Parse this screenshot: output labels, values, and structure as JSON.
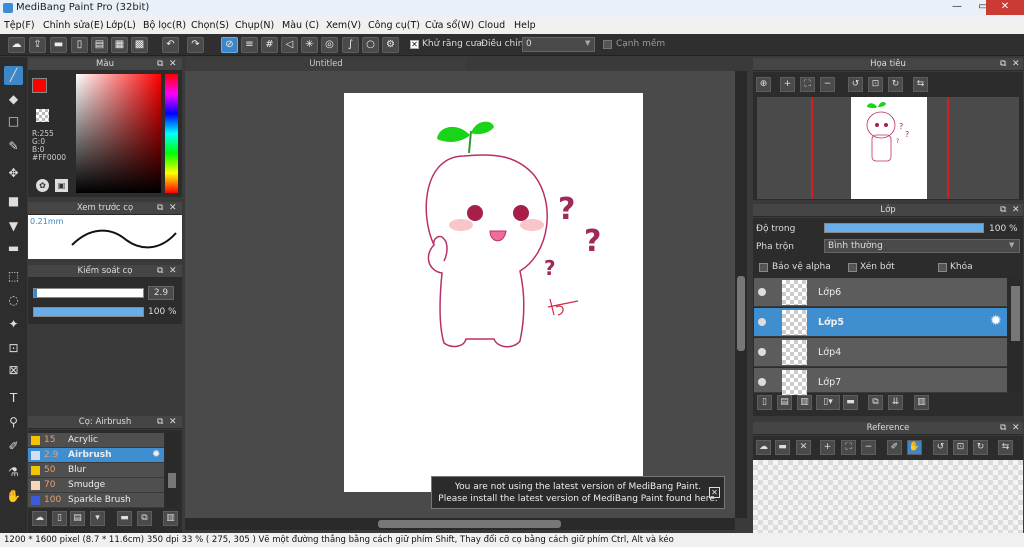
{
  "window": {
    "title": "MediBang Paint Pro (32bit)",
    "min": "—",
    "max": "▭",
    "close": "✕"
  },
  "menu": [
    "Tệp(F)",
    "Chỉnh sửa(E)",
    "Lớp(L)",
    "Bộ lọc(R)",
    "Chọn(S)",
    "Chụp(N)",
    "Màu (C)",
    "Xem(V)",
    "Công cụ(T)",
    "Cửa sổ(W)",
    "Cloud",
    "Help"
  ],
  "toolbar": {
    "antialias_label": "Khử răng cưa",
    "adjust_label": "Điều chỉnh",
    "adjust_value": "0",
    "edge_label": "Cạnh mềm"
  },
  "color_panel": {
    "title": "Màu",
    "r": "R:255",
    "g": "G:0",
    "b": "B:0",
    "hex": "#FF0000",
    "primary": "#ff0000"
  },
  "brush_preview": {
    "title": "Xem trước cọ",
    "size": "0.21mm"
  },
  "brush_control": {
    "title": "Kiểm soát cọ",
    "size": "2.9",
    "opacity": "100 %"
  },
  "brush_panel": {
    "title": "Cọ: Airbrush",
    "items": [
      {
        "size": "15",
        "name": "Acrylic",
        "color": "#f5c400"
      },
      {
        "size": "2.9",
        "name": "Airbrush",
        "color": "#cfe0f5"
      },
      {
        "size": "50",
        "name": "Blur",
        "color": "#f5c400"
      },
      {
        "size": "70",
        "name": "Smudge",
        "color": "#f5d6b8"
      },
      {
        "size": "100",
        "name": "Sparkle Brush",
        "color": "#3a5ad8"
      }
    ]
  },
  "canvas": {
    "tab": "Untitled"
  },
  "navigator": {
    "title": "Họa tiêu"
  },
  "layer_panel": {
    "title": "Lớp",
    "opacity_label": "Độ trong",
    "opacity_value": "100 %",
    "opacity": 1.0,
    "blend_label": "Pha trộn",
    "blend_value": "Bình thường",
    "protect_alpha": "Bảo vệ alpha",
    "clipping": "Xén bớt",
    "lock": "Khóa",
    "layers": [
      {
        "name": "Lớp6"
      },
      {
        "name": "Lớp5"
      },
      {
        "name": "Lớp4"
      },
      {
        "name": "Lớp7"
      }
    ]
  },
  "reference": {
    "title": "Reference"
  },
  "notification": {
    "line1": "You are not using the latest version of MediBang Paint.",
    "line2": "Please install the latest version of MediBang Paint found here."
  },
  "status": {
    "text": "1200 * 1600 pixel   (8.7 * 11.6cm)   350 dpi   33 %   ( 275, 305 )   Vẽ một đường thẳng bằng cách giữ phím Shift, Thay đổi cỡ cọ bằng cách giữ phím Ctrl, Alt và kéo"
  }
}
